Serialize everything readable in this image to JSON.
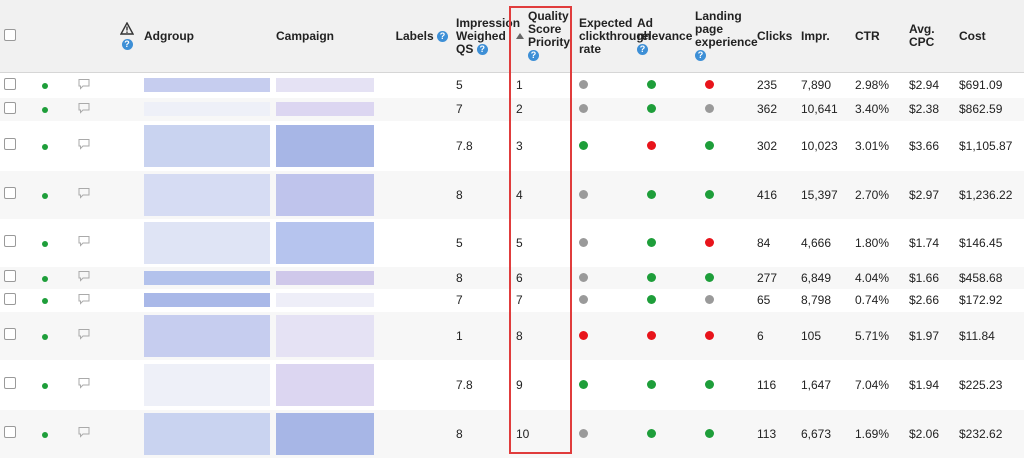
{
  "headers": {
    "adgroup": "Adgroup",
    "campaign": "Campaign",
    "labels": "Labels",
    "impression_weighed_qs": [
      "Impression",
      "Weighed",
      "QS"
    ],
    "qs_priority": [
      "Quality",
      "Score",
      "Priority"
    ],
    "expected_ctr": [
      "Expected",
      "clickthrough",
      "rate"
    ],
    "ad_relevance": [
      "Ad",
      "relevance"
    ],
    "landing_page": [
      "Landing",
      "page",
      "experience"
    ],
    "clicks": "Clicks",
    "impr": "Impr.",
    "ctr": "CTR",
    "avg_cpc": [
      "Avg.",
      "CPC"
    ],
    "cost": "Cost"
  },
  "warning_icon": "warning-triangle-icon",
  "help_icon_glyph": "?",
  "status_colors": {
    "green": "#1e9e3a",
    "red": "#e8141b",
    "gray": "#9a9a9a",
    "highlight": "#e03c3c"
  },
  "rows": [
    {
      "qs": "5",
      "priority": "1",
      "ectr": "gray",
      "adrel": "green",
      "lp": "red",
      "clicks": "235",
      "impr": "7,890",
      "ctr": "2.98%",
      "cpc": "$2.94",
      "cost": "$691.09"
    },
    {
      "qs": "7",
      "priority": "2",
      "ectr": "gray",
      "adrel": "green",
      "lp": "gray",
      "clicks": "362",
      "impr": "10,641",
      "ctr": "3.40%",
      "cpc": "$2.38",
      "cost": "$862.59"
    },
    {
      "qs": "7.8",
      "priority": "3",
      "ectr": "green",
      "adrel": "red",
      "lp": "green",
      "clicks": "302",
      "impr": "10,023",
      "ctr": "3.01%",
      "cpc": "$3.66",
      "cost": "$1,105.87"
    },
    {
      "qs": "8",
      "priority": "4",
      "ectr": "gray",
      "adrel": "green",
      "lp": "green",
      "clicks": "416",
      "impr": "15,397",
      "ctr": "2.70%",
      "cpc": "$2.97",
      "cost": "$1,236.22"
    },
    {
      "qs": "5",
      "priority": "5",
      "ectr": "gray",
      "adrel": "green",
      "lp": "red",
      "clicks": "84",
      "impr": "4,666",
      "ctr": "1.80%",
      "cpc": "$1.74",
      "cost": "$146.45"
    },
    {
      "qs": "8",
      "priority": "6",
      "ectr": "gray",
      "adrel": "green",
      "lp": "green",
      "clicks": "277",
      "impr": "6,849",
      "ctr": "4.04%",
      "cpc": "$1.66",
      "cost": "$458.68"
    },
    {
      "qs": "7",
      "priority": "7",
      "ectr": "gray",
      "adrel": "green",
      "lp": "gray",
      "clicks": "65",
      "impr": "8,798",
      "ctr": "0.74%",
      "cpc": "$2.66",
      "cost": "$172.92"
    },
    {
      "qs": "1",
      "priority": "8",
      "ectr": "red",
      "adrel": "red",
      "lp": "red",
      "clicks": "6",
      "impr": "105",
      "ctr": "5.71%",
      "cpc": "$1.97",
      "cost": "$11.84"
    },
    {
      "qs": "7.8",
      "priority": "9",
      "ectr": "green",
      "adrel": "green",
      "lp": "green",
      "clicks": "116",
      "impr": "1,647",
      "ctr": "7.04%",
      "cpc": "$1.94",
      "cost": "$225.23"
    },
    {
      "qs": "8",
      "priority": "10",
      "ectr": "gray",
      "adrel": "green",
      "lp": "green",
      "clicks": "113",
      "impr": "6,673",
      "ctr": "1.69%",
      "cpc": "$2.06",
      "cost": "$232.62"
    }
  ]
}
